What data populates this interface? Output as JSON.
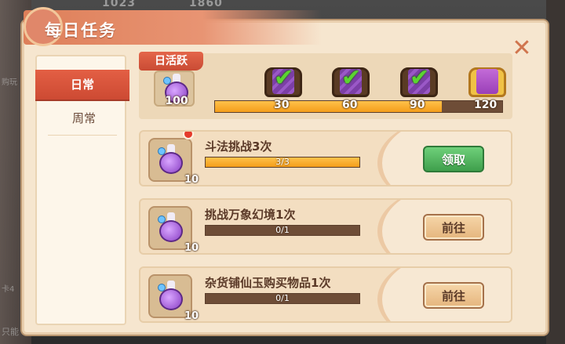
{
  "background": {
    "top_numbers": [
      "1023",
      "1860"
    ],
    "left_hints": [
      "购玩",
      "卡4",
      "只能"
    ]
  },
  "window": {
    "title": "每日任务",
    "close_symbol": "✕"
  },
  "tabs": [
    {
      "label": "日常",
      "active": true
    },
    {
      "label": "周常",
      "active": false
    }
  ],
  "activity": {
    "label": "日活跃",
    "current_points": "100",
    "progress_percent": 79,
    "milestones": [
      {
        "value": "30",
        "claimed": true,
        "icon": "purple-chest-icon"
      },
      {
        "value": "60",
        "claimed": true,
        "icon": "purple-chest-icon"
      },
      {
        "value": "90",
        "claimed": true,
        "icon": "purple-chest-icon"
      },
      {
        "value": "120",
        "claimed": false,
        "icon": "gold-chest-icon"
      }
    ]
  },
  "tasks": [
    {
      "name": "斗法挑战3次",
      "reward": "10",
      "progress_text": "3/3",
      "progress_fraction": 1.0,
      "button": "领取",
      "button_type": "claim",
      "red_dot": true
    },
    {
      "name": "挑战万象幻境1次",
      "reward": "10",
      "progress_text": "0/1",
      "progress_fraction": 0,
      "button": "前往",
      "button_type": "go",
      "red_dot": false
    },
    {
      "name": "杂货铺仙玉购买物品1次",
      "reward": "10",
      "progress_text": "0/1",
      "progress_fraction": 0,
      "button": "前往",
      "button_type": "go",
      "red_dot": false
    }
  ],
  "colors": {
    "accent_red": "#e35f44",
    "claim_green": "#4caf50",
    "bar_fill": "#f49d1a"
  }
}
